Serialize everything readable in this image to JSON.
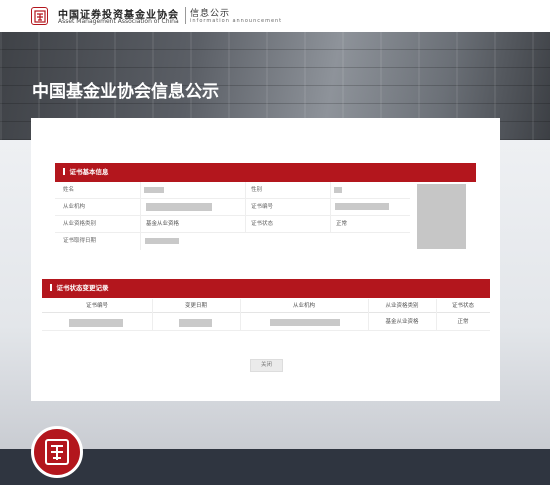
{
  "header": {
    "org_name_cn": "中国证券投资基金业协会",
    "org_name_en": "Asset Management Association of China",
    "section_cn": "信息公示",
    "section_en": "information announcement"
  },
  "hero": {
    "title": "中国基金业协会信息公示"
  },
  "basic_info": {
    "title": "证书基本信息",
    "labels": {
      "name": "姓名",
      "gender": "性别",
      "institution": "从业机构",
      "cert_no": "证书编号",
      "qualification": "从业资格类别",
      "cert_status": "证书状态",
      "issue_date": "证书取得日期"
    },
    "values": {
      "qualification": "基金从业资格",
      "cert_status": "正常"
    }
  },
  "change_records": {
    "title": "证书状态变更记录",
    "columns": [
      "证书编号",
      "变更日期",
      "从业机构",
      "从业资格类别",
      "证书状态"
    ],
    "rows": [
      {
        "qualification": "基金从业资格",
        "status": "正常"
      }
    ]
  },
  "actions": {
    "close_label": "关闭"
  },
  "colors": {
    "brand_red": "#b3161d",
    "footer_dark": "#2f3540"
  }
}
